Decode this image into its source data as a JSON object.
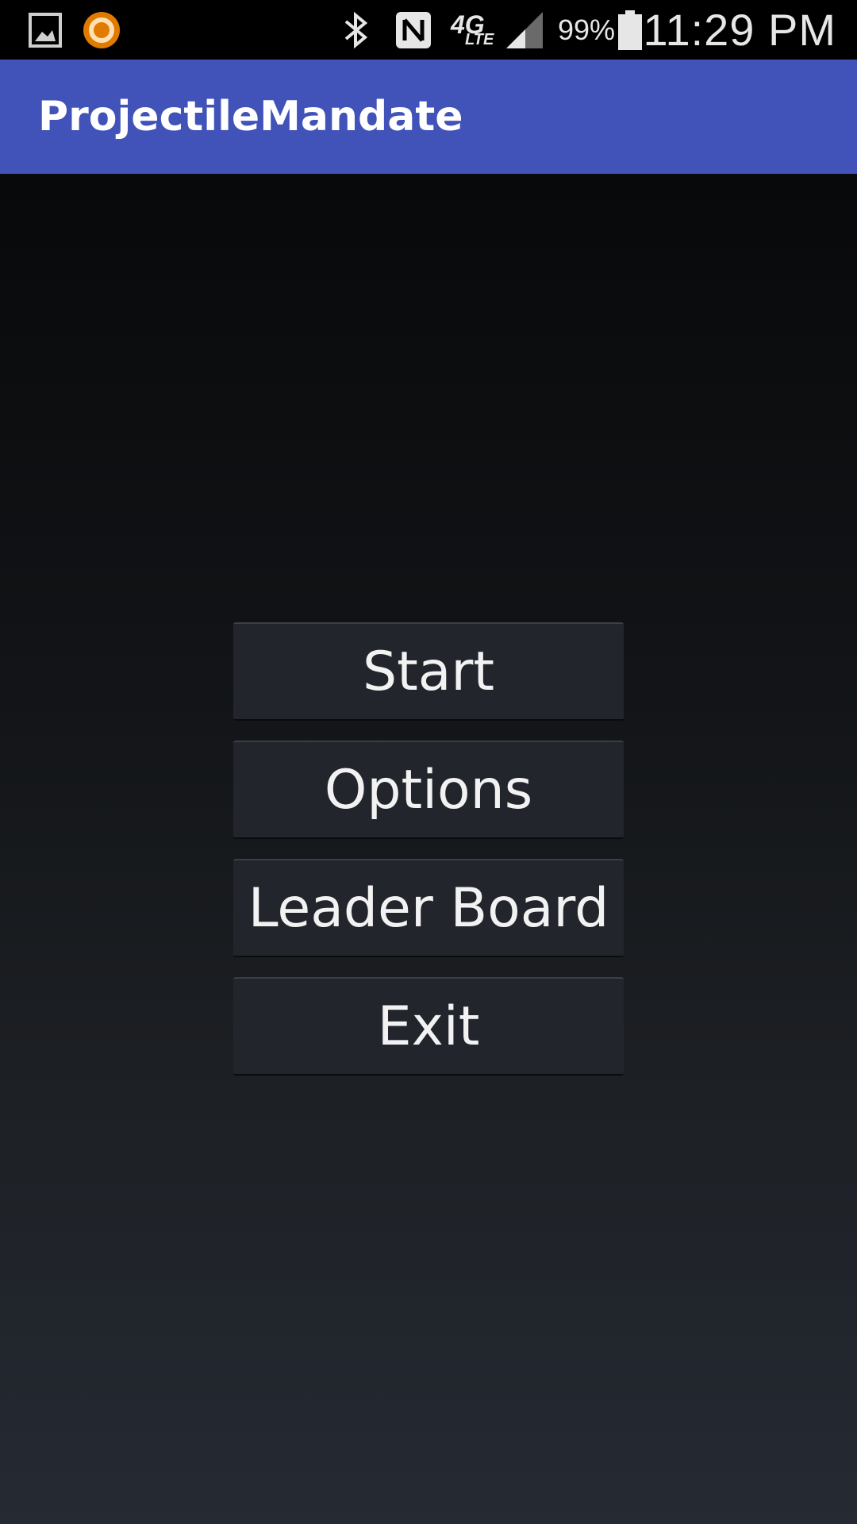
{
  "status_bar": {
    "left_icons": [
      "gallery-icon",
      "app-notification-icon"
    ],
    "right_icons": [
      "bluetooth-icon",
      "nfc-icon",
      "4g-lte-icon",
      "signal-icon",
      "battery-icon"
    ],
    "network_label": "4G",
    "network_sub": "LTE",
    "battery": "99%",
    "time": "11:29 PM"
  },
  "app_bar": {
    "title": "ProjectileMandate",
    "color": "#4152b8"
  },
  "menu": {
    "buttons": [
      {
        "label": "Start"
      },
      {
        "label": "Options"
      },
      {
        "label": "Leader Board"
      },
      {
        "label": "Exit"
      }
    ]
  }
}
